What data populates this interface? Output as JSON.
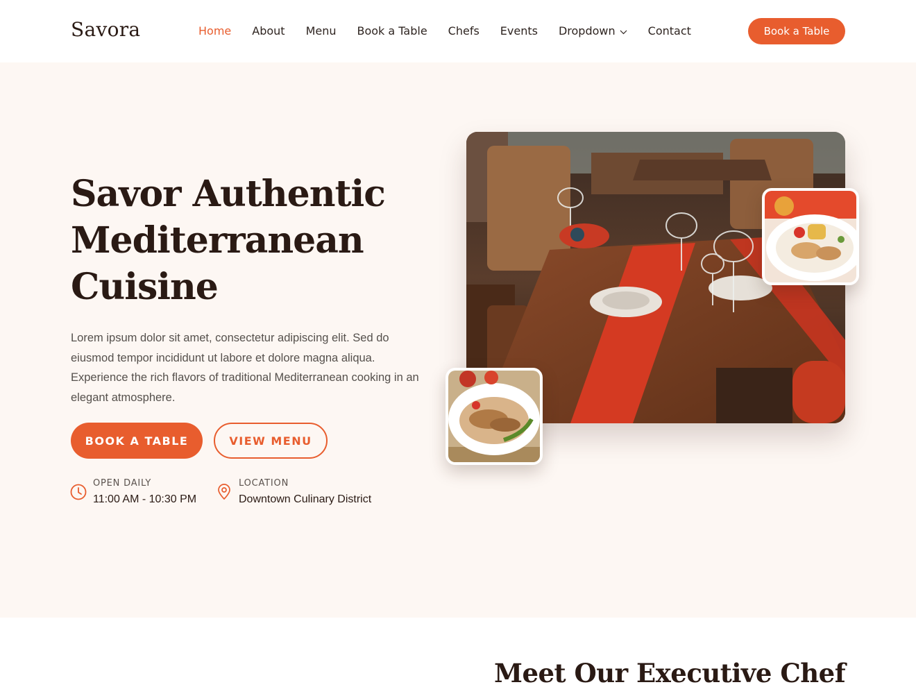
{
  "brand": {
    "name": "Savora"
  },
  "nav": {
    "items": [
      {
        "label": "Home",
        "active": true
      },
      {
        "label": "About"
      },
      {
        "label": "Menu"
      },
      {
        "label": "Book a Table"
      },
      {
        "label": "Chefs"
      },
      {
        "label": "Events"
      },
      {
        "label": "Dropdown",
        "icon": "chevron-down-icon"
      },
      {
        "label": "Contact"
      }
    ],
    "cta_label": "Book a Table"
  },
  "hero": {
    "title_lines": [
      "Savor Authentic",
      "Mediterranean",
      "Cuisine"
    ],
    "description": "Lorem ipsum dolor sit amet, consectetur adipiscing elit. Sed do eiusmod tempor incididunt ut labore et dolore magna aliqua. Experience the rich flavors of traditional Mediterranean cooking in an elegant atmosphere.",
    "primary_button": "BOOK A TABLE",
    "secondary_button": "VIEW MENU",
    "info": {
      "hours": {
        "label": "OPEN DAILY",
        "value": "11:00 AM - 10:30 PM",
        "icon": "clock-icon"
      },
      "location": {
        "label": "LOCATION",
        "value": "Downtown Culinary District",
        "icon": "map-pin-icon"
      }
    }
  },
  "chef_section": {
    "title": "Meet Our Executive Chef"
  },
  "colors": {
    "accent": "#e85d2e",
    "hero_bg": "#fdf7f3",
    "heading": "#2a1a14",
    "body_text": "#55504c"
  }
}
